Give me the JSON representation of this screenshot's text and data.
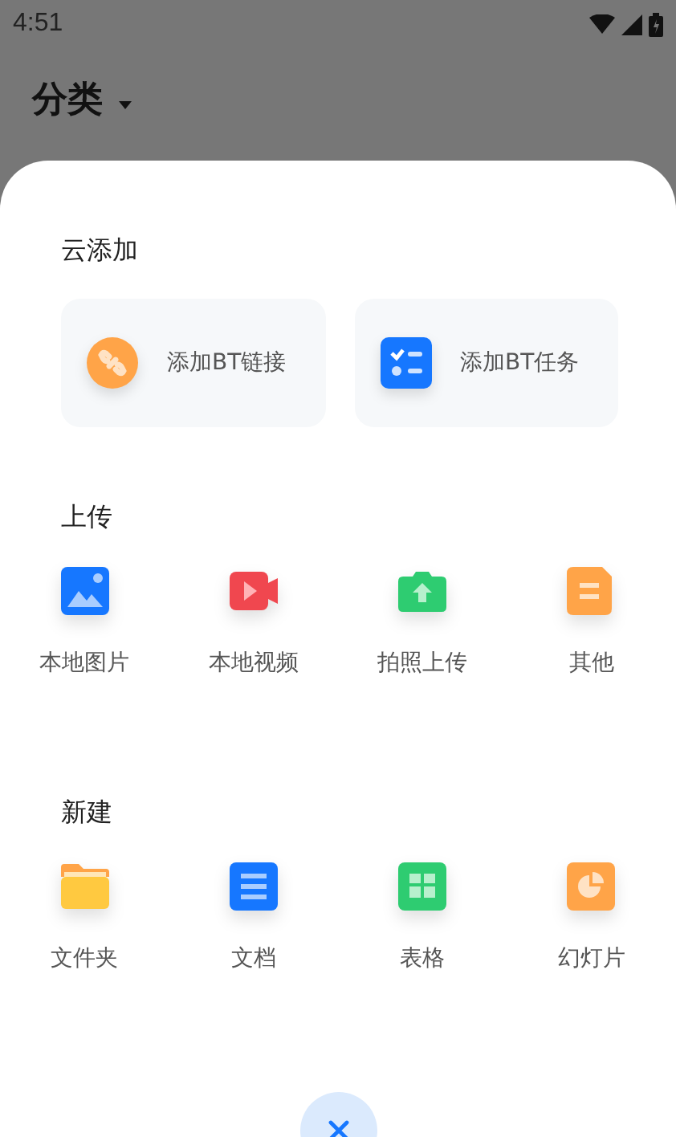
{
  "status_bar": {
    "time": "4:51"
  },
  "header": {
    "title": "分类"
  },
  "sheet": {
    "cloud": {
      "title": "云添加",
      "cards": [
        {
          "kind": "link",
          "label": "添加BT链接"
        },
        {
          "kind": "task",
          "label": "添加BT任务"
        }
      ]
    },
    "upload": {
      "title": "上传",
      "items": [
        {
          "kind": "image",
          "label": "本地图片"
        },
        {
          "kind": "video",
          "label": "本地视频"
        },
        {
          "kind": "camera",
          "label": "拍照上传"
        },
        {
          "kind": "file",
          "label": "其他"
        }
      ]
    },
    "create": {
      "title": "新建",
      "items": [
        {
          "kind": "folder",
          "label": "文件夹"
        },
        {
          "kind": "doc",
          "label": "文档"
        },
        {
          "kind": "sheet",
          "label": "表格"
        },
        {
          "kind": "slides",
          "label": "幻灯片"
        }
      ]
    }
  }
}
